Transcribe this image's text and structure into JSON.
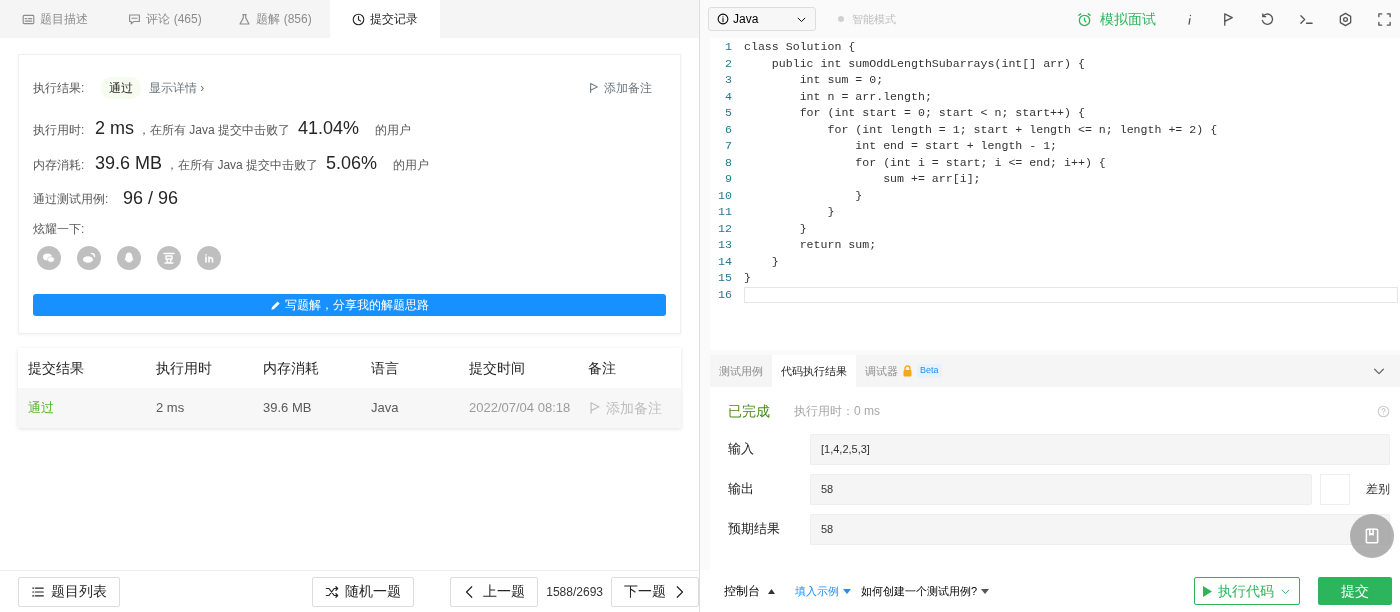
{
  "left_tabs": [
    {
      "label": "题目描述",
      "selected": false
    },
    {
      "label": "评论 (465)",
      "selected": false
    },
    {
      "label": "题解 (856)",
      "selected": false
    },
    {
      "label": "提交记录",
      "selected": true
    }
  ],
  "result_card": {
    "status_label": "执行结果:",
    "status": "通过",
    "details_link": "显示详情 ›",
    "add_note": "添加备注",
    "stats": [
      {
        "label": "执行用时:",
        "value": "2 ms",
        "text": "，在所有 Java 提交中击败了",
        "percent": "41.04%",
        "suffix": "的用户"
      },
      {
        "label": "内存消耗:",
        "value": "39.6 MB",
        "text": "，在所有 Java 提交中击败了",
        "percent": "5.06%",
        "suffix": "的用户"
      }
    ],
    "tests_label": "通过测试用例:",
    "tests_value": "96 / 96",
    "share_label": "炫耀一下:",
    "share_button": "写题解，分享我的解题思路"
  },
  "submissions": {
    "columns": [
      "提交结果",
      "执行用时",
      "内存消耗",
      "语言",
      "提交时间",
      "备注"
    ],
    "rows": [
      {
        "status": "通过",
        "time": "2 ms",
        "memory": "39.6 MB",
        "language": "Java",
        "submitted": "2022/07/04 08:18",
        "note": "添加备注"
      }
    ]
  },
  "left_footer": {
    "list_button": "题目列表",
    "random_button": "随机一题",
    "prev_button": "上一题",
    "counter": "1588/2693",
    "next_button": "下一题"
  },
  "editor": {
    "language": "Java",
    "smart_mode": "智能模式",
    "mock_interview": "模拟面试",
    "lines": [
      {
        "number": "1",
        "active": false,
        "code": "class Solution {"
      },
      {
        "number": "2",
        "active": false,
        "code": "    public int sumOddLengthSubarrays(int[] arr) {"
      },
      {
        "number": "3",
        "active": false,
        "code": "        int sum = 0;"
      },
      {
        "number": "4",
        "active": false,
        "code": "        int n = arr.length;"
      },
      {
        "number": "5",
        "active": false,
        "code": "        for (int start = 0; start < n; start++) {"
      },
      {
        "number": "6",
        "active": false,
        "code": "            for (int length = 1; start + length <= n; length += 2) {"
      },
      {
        "number": "7",
        "active": false,
        "code": "                int end = start + length - 1;"
      },
      {
        "number": "8",
        "active": false,
        "code": "                for (int i = start; i <= end; i++) {"
      },
      {
        "number": "9",
        "active": false,
        "code": "                    sum += arr[i];"
      },
      {
        "number": "10",
        "active": false,
        "code": "                }"
      },
      {
        "number": "11",
        "active": false,
        "code": "            }"
      },
      {
        "number": "12",
        "active": false,
        "code": "        }"
      },
      {
        "number": "13",
        "active": false,
        "code": "        return sum;"
      },
      {
        "number": "14",
        "active": false,
        "code": "    }"
      },
      {
        "number": "15",
        "active": false,
        "code": "}"
      },
      {
        "number": "16",
        "active": true
      }
    ]
  },
  "console_tabs": [
    {
      "label": "测试用例",
      "selected": false
    },
    {
      "label": "代码执行结果",
      "selected": true
    },
    {
      "label": "调试器",
      "selected": false,
      "locked": true,
      "badge": "Beta"
    }
  ],
  "run_result": {
    "status": "已完成",
    "time": "执行用时：0 ms",
    "diff_label": "差别",
    "diff_on": false,
    "fields": [
      {
        "label": "输入",
        "value": "[1,4,2,5,3]"
      },
      {
        "label": "输出",
        "value": "58"
      },
      {
        "label": "预期结果",
        "value": "58"
      }
    ]
  },
  "right_footer": {
    "console": "控制台",
    "fill_example": "填入示例",
    "how_to": "如何创建一个测试用例?",
    "run_button": "执行代码",
    "submit_button": "提交"
  }
}
